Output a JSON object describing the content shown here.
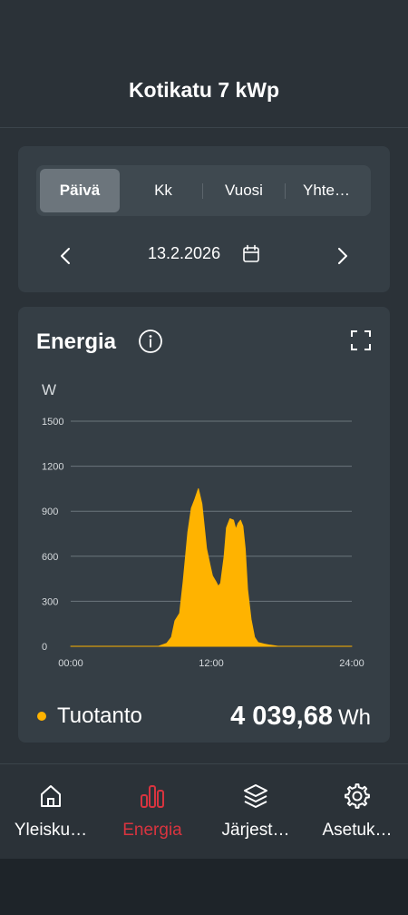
{
  "header": {
    "title": "Kotikatu 7 kWp"
  },
  "period_tabs": [
    {
      "label": "Päivä",
      "active": true
    },
    {
      "label": "Kk",
      "active": false
    },
    {
      "label": "Vuosi",
      "active": false
    },
    {
      "label": "Yhte…",
      "active": false
    }
  ],
  "date_nav": {
    "date": "13.2.2026",
    "prev_icon": "chevron-left-icon",
    "next_icon": "chevron-right-icon",
    "calendar_icon": "calendar-icon"
  },
  "energy_card": {
    "title": "Energia",
    "info_icon": "info-icon",
    "fullscreen_icon": "fullscreen-icon",
    "unit": "W",
    "legend_label": "Tuotanto",
    "total_value": "4 039,68",
    "total_unit": "Wh"
  },
  "chart_data": {
    "type": "area",
    "ylabel": "W",
    "ylim": [
      0,
      1500
    ],
    "yticks": [
      "0",
      "300",
      "600",
      "900",
      "1200",
      "1500"
    ],
    "xticks": [
      "00:00",
      "12:00",
      "24:00"
    ],
    "x_unit": "hours",
    "series": [
      {
        "name": "Tuotanto",
        "color": "#ffb300",
        "x": [
          0,
          7.5,
          8.2,
          8.6,
          8.9,
          9.3,
          9.6,
          10.0,
          10.3,
          10.6,
          10.9,
          11.2,
          11.6,
          11.9,
          12.1,
          12.4,
          12.6,
          12.8,
          13.1,
          13.3,
          13.6,
          13.9,
          14.1,
          14.3,
          14.5,
          14.7,
          14.9,
          15.1,
          15.4,
          15.7,
          16.0,
          16.5,
          17.0,
          17.7,
          24
        ],
        "values": [
          0,
          0,
          20,
          60,
          170,
          220,
          430,
          760,
          920,
          980,
          1050,
          950,
          650,
          540,
          470,
          430,
          400,
          420,
          600,
          790,
          850,
          840,
          780,
          820,
          840,
          800,
          650,
          380,
          180,
          60,
          25,
          15,
          8,
          0,
          0
        ]
      }
    ],
    "grid": true
  },
  "bottom_nav": [
    {
      "label": "Yleisku…",
      "icon": "home-icon",
      "active": false
    },
    {
      "label": "Energia",
      "icon": "bar-chart-icon",
      "active": true
    },
    {
      "label": "Järjest…",
      "icon": "layers-icon",
      "active": false
    },
    {
      "label": "Asetuk…",
      "icon": "gear-icon",
      "active": false
    }
  ],
  "colors": {
    "accent": "#d8343f",
    "series": "#ffb300",
    "background": "#2b3238",
    "card": "#353e45"
  }
}
